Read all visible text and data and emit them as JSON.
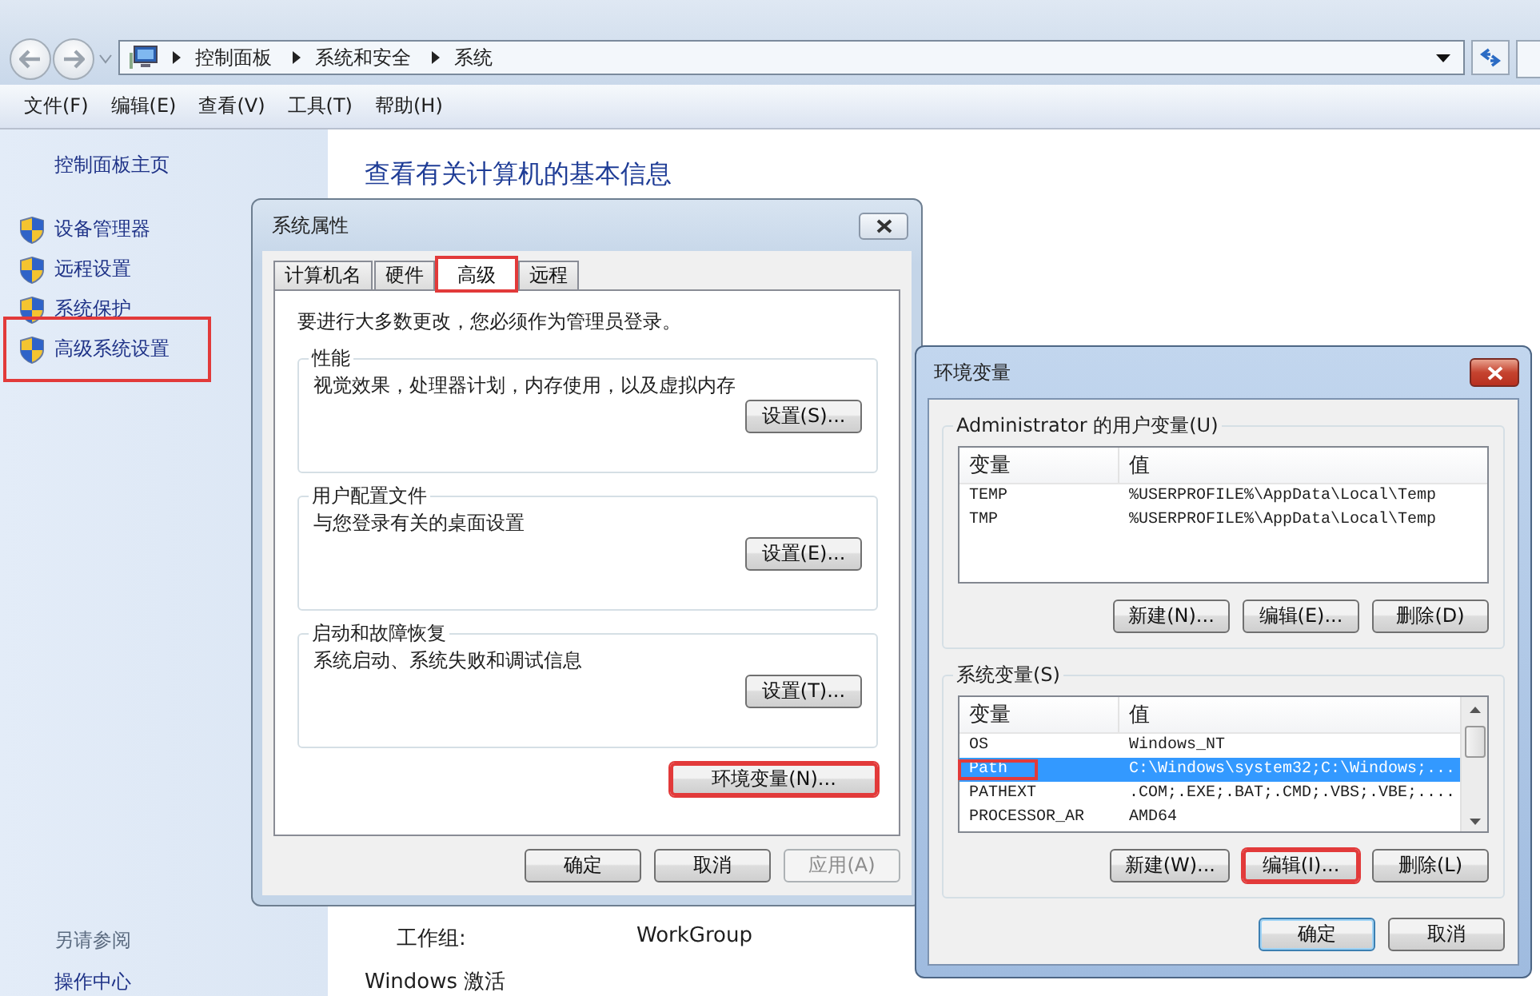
{
  "explorer": {
    "breadcrumbs": [
      "控制面板",
      "系统和安全",
      "系统"
    ],
    "menu": [
      "文件(F)",
      "编辑(E)",
      "查看(V)",
      "工具(T)",
      "帮助(H)"
    ],
    "sidebar": {
      "home": "控制面板主页",
      "items": [
        {
          "label": "设备管理器",
          "highlighted": false
        },
        {
          "label": "远程设置",
          "highlighted": false
        },
        {
          "label": "系统保护",
          "highlighted": false
        },
        {
          "label": "高级系统设置",
          "highlighted": true
        }
      ],
      "see_also": "另请参阅",
      "links": [
        "操作中心"
      ]
    },
    "heading": "查看有关计算机的基本信息",
    "info_rows": [
      {
        "label": "工作组:",
        "value": "WorkGroup"
      }
    ],
    "section": "Windows 激活"
  },
  "system_properties": {
    "title": "系统属性",
    "tabs": [
      {
        "label": "计算机名",
        "selected": false,
        "highlighted": false
      },
      {
        "label": "硬件",
        "selected": false,
        "highlighted": false
      },
      {
        "label": "高级",
        "selected": true,
        "highlighted": true
      },
      {
        "label": "远程",
        "selected": false,
        "highlighted": false
      }
    ],
    "notice": "要进行大多数更改，您必须作为管理员登录。",
    "groups": [
      {
        "title": "性能",
        "description": "视觉效果，处理器计划，内存使用，以及虚拟内存",
        "button": "设置(S)..."
      },
      {
        "title": "用户配置文件",
        "description": "与您登录有关的桌面设置",
        "button": "设置(E)..."
      },
      {
        "title": "启动和故障恢复",
        "description": "系统启动、系统失败和调试信息",
        "button": "设置(T)..."
      }
    ],
    "env_button": {
      "label": "环境变量(N)...",
      "highlighted": true
    },
    "buttons": [
      {
        "label": "确定",
        "disabled": false
      },
      {
        "label": "取消",
        "disabled": false
      },
      {
        "label": "应用(A)",
        "disabled": true
      }
    ]
  },
  "environment_variables": {
    "title": "环境变量",
    "user_vars": {
      "title": "Administrator 的用户变量(U)",
      "columns": [
        "变量",
        "值"
      ],
      "rows": [
        {
          "name": "TEMP",
          "value": "%USERPROFILE%\\AppData\\Local\\Temp",
          "selected": false,
          "highlighted": false
        },
        {
          "name": "TMP",
          "value": "%USERPROFILE%\\AppData\\Local\\Temp",
          "selected": false,
          "highlighted": false
        }
      ],
      "buttons": [
        {
          "label": "新建(N)...",
          "highlighted": false
        },
        {
          "label": "编辑(E)...",
          "highlighted": false
        },
        {
          "label": "删除(D)",
          "highlighted": false
        }
      ]
    },
    "system_vars": {
      "title": "系统变量(S)",
      "columns": [
        "变量",
        "值"
      ],
      "rows": [
        {
          "name": "OS",
          "value": "Windows_NT",
          "selected": false,
          "highlighted": false
        },
        {
          "name": "Path",
          "value": "C:\\Windows\\system32;C:\\Windows;...",
          "selected": true,
          "highlighted": true
        },
        {
          "name": "PATHEXT",
          "value": ".COM;.EXE;.BAT;.CMD;.VBS;.VBE;....",
          "selected": false,
          "highlighted": false
        },
        {
          "name": "PROCESSOR_AR",
          "value": "AMD64",
          "selected": false,
          "highlighted": false
        }
      ],
      "buttons": [
        {
          "label": "新建(W)...",
          "highlighted": false
        },
        {
          "label": "编辑(I)...",
          "highlighted": true
        },
        {
          "label": "删除(L)",
          "highlighted": false
        }
      ]
    },
    "buttons": [
      {
        "label": "确定",
        "default": true
      },
      {
        "label": "取消",
        "default": false
      }
    ]
  }
}
